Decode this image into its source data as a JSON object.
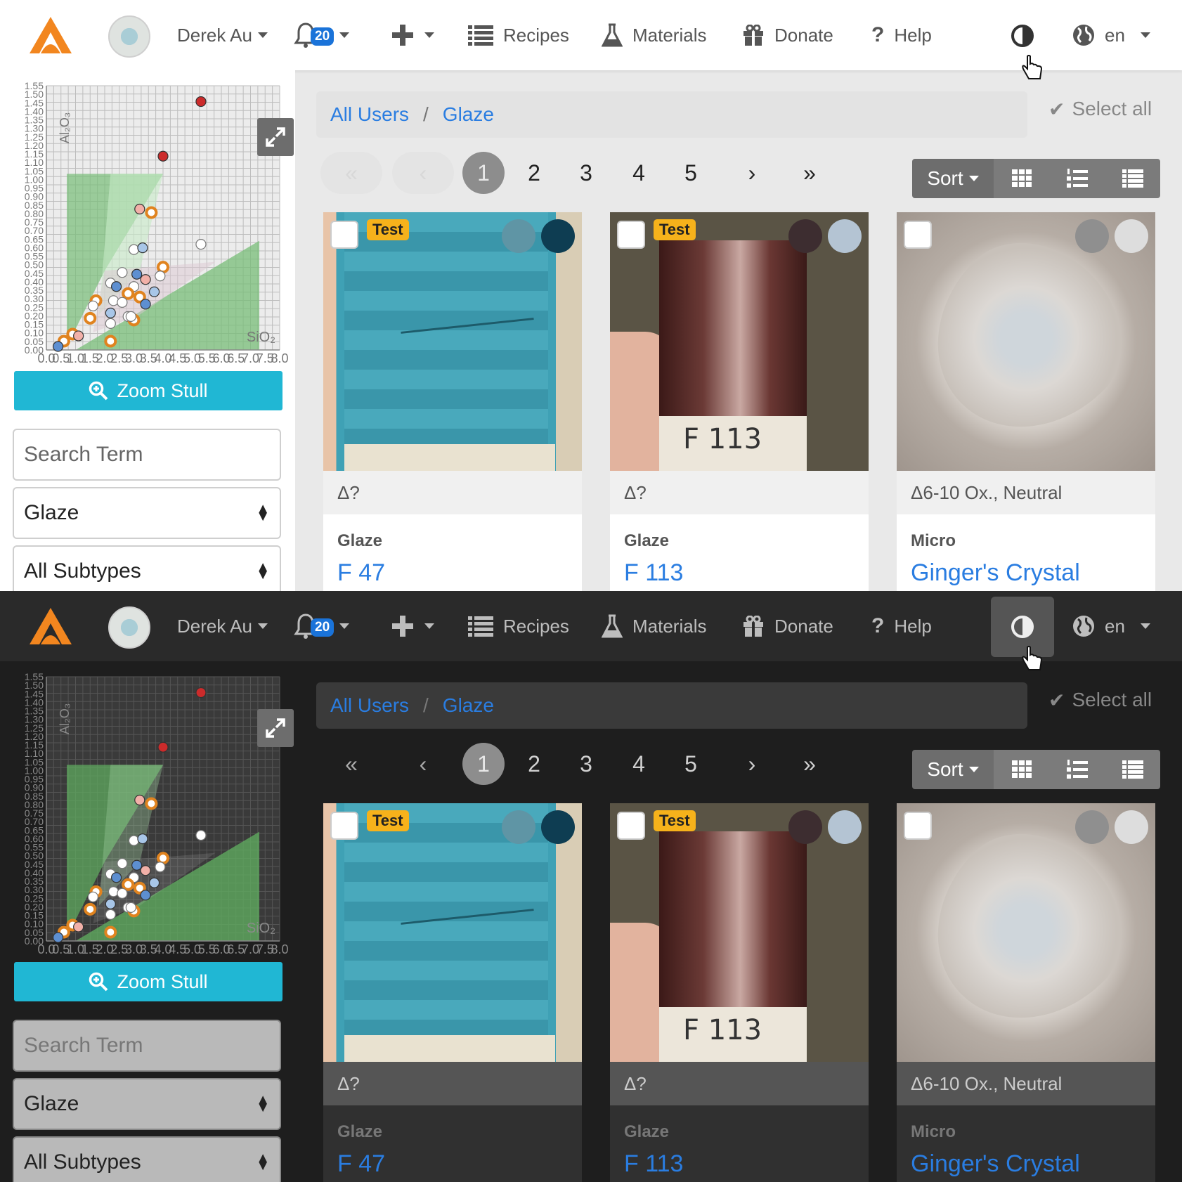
{
  "navbar": {
    "user_name": "Derek Au",
    "notification_count": "20",
    "recipes_label": "Recipes",
    "materials_label": "Materials",
    "donate_label": "Donate",
    "help_label": "Help",
    "language": "en"
  },
  "sidebar": {
    "zoom_label": "Zoom Stull",
    "search_placeholder": "Search Term",
    "type_value": "Glaze",
    "subtype_value": "All Subtypes"
  },
  "breadcrumb": [
    "All Users",
    "Glaze"
  ],
  "select_all_label": "Select all",
  "pagination": {
    "first": "«",
    "prev": "‹",
    "pages": [
      "1",
      "2",
      "3",
      "4",
      "5"
    ],
    "active": "1",
    "next": "›",
    "last": "»"
  },
  "sort_label": "Sort",
  "cards": [
    {
      "badge": "Test",
      "cone": "Δ?",
      "type": "Glaze",
      "name": "F 47",
      "swatches": [
        "#5f95a5",
        "#0e3d52"
      ]
    },
    {
      "badge": "Test",
      "cone": "Δ?",
      "type": "Glaze",
      "name": "F 113",
      "swatches": [
        "#3d2d30",
        "#b4c4d3"
      ]
    },
    {
      "badge": "",
      "cone": "Δ6-10 Ox., Neutral",
      "type": "Micro",
      "name": "Ginger's Crystal",
      "swatches": [
        "#8f8f8f",
        "#dddddd"
      ]
    }
  ],
  "chart_data": {
    "type": "scatter",
    "title": "",
    "xlabel": "SiO₂",
    "ylabel": "Al₂O₃",
    "xlim": [
      0.0,
      8.0
    ],
    "ylim": [
      0.0,
      1.5
    ],
    "x_ticks": [
      "0.0",
      "0.5",
      "1.0",
      "1.5",
      "2.0",
      "2.5",
      "3.0",
      "3.5",
      "4.0",
      "4.5",
      "5.0",
      "5.5",
      "6.0",
      "6.5",
      "7.0",
      "7.5",
      "8.0"
    ],
    "y_ticks": [
      "0.00",
      "0.05",
      "0.10",
      "0.15",
      "0.20",
      "0.25",
      "0.30",
      "0.35",
      "0.40",
      "0.45",
      "0.50",
      "0.55",
      "0.60",
      "0.65",
      "0.70",
      "0.75",
      "0.80",
      "0.85",
      "0.90",
      "0.95",
      "1.00",
      "1.05",
      "1.10",
      "1.15",
      "1.20",
      "1.25",
      "1.30",
      "1.35",
      "1.40",
      "1.45",
      "1.50",
      "1.55"
    ],
    "points": [
      {
        "x": 5.3,
        "y": 1.41,
        "color": "#cc2b2b"
      },
      {
        "x": 4.0,
        "y": 1.1,
        "color": "#cc2b2b"
      },
      {
        "x": 3.2,
        "y": 0.8,
        "color": "#f2b0a8"
      },
      {
        "x": 3.6,
        "y": 0.78,
        "color": "#e88b4a"
      },
      {
        "x": 5.3,
        "y": 0.6,
        "color": "#ffffff"
      },
      {
        "x": 3.0,
        "y": 0.57,
        "color": "#ffffff"
      },
      {
        "x": 3.3,
        "y": 0.58,
        "color": "#a8c6e8"
      },
      {
        "x": 4.0,
        "y": 0.47,
        "color": "#e88b4a"
      },
      {
        "x": 3.9,
        "y": 0.42,
        "color": "#ffffff"
      },
      {
        "x": 2.6,
        "y": 0.44,
        "color": "#ffffff"
      },
      {
        "x": 3.1,
        "y": 0.43,
        "color": "#5d8fd1"
      },
      {
        "x": 2.2,
        "y": 0.38,
        "color": "#ffffff"
      },
      {
        "x": 2.4,
        "y": 0.36,
        "color": "#5d8fd1"
      },
      {
        "x": 3.4,
        "y": 0.4,
        "color": "#f2b0a8"
      },
      {
        "x": 3.0,
        "y": 0.36,
        "color": "#ffffff"
      },
      {
        "x": 3.7,
        "y": 0.33,
        "color": "#a8c6e8"
      },
      {
        "x": 2.8,
        "y": 0.32,
        "color": "#e88b4a"
      },
      {
        "x": 3.2,
        "y": 0.3,
        "color": "#e88b4a"
      },
      {
        "x": 1.7,
        "y": 0.28,
        "color": "#e88b4a"
      },
      {
        "x": 2.3,
        "y": 0.28,
        "color": "#ffffff"
      },
      {
        "x": 2.6,
        "y": 0.27,
        "color": "#ffffff"
      },
      {
        "x": 3.4,
        "y": 0.26,
        "color": "#5d8fd1"
      },
      {
        "x": 1.6,
        "y": 0.25,
        "color": "#ffffff"
      },
      {
        "x": 2.2,
        "y": 0.21,
        "color": "#a8c6e8"
      },
      {
        "x": 2.8,
        "y": 0.19,
        "color": "#ffffff"
      },
      {
        "x": 1.5,
        "y": 0.18,
        "color": "#e88b4a"
      },
      {
        "x": 3.0,
        "y": 0.17,
        "color": "#e88b4a"
      },
      {
        "x": 2.2,
        "y": 0.15,
        "color": "#ffffff"
      },
      {
        "x": 2.9,
        "y": 0.19,
        "color": "#ffffff"
      },
      {
        "x": 0.9,
        "y": 0.09,
        "color": "#e88b4a"
      },
      {
        "x": 1.1,
        "y": 0.08,
        "color": "#f2b0a8"
      },
      {
        "x": 2.2,
        "y": 0.05,
        "color": "#e88b4a"
      },
      {
        "x": 0.6,
        "y": 0.05,
        "color": "#e88b4a"
      },
      {
        "x": 0.4,
        "y": 0.02,
        "color": "#5d8fd1"
      }
    ],
    "grid": true
  },
  "colors": {
    "link": "#2a7de1",
    "zoom_button": "#20b7d4",
    "test_badge": "#f6b21b",
    "notification_badge": "#1a73d9"
  }
}
